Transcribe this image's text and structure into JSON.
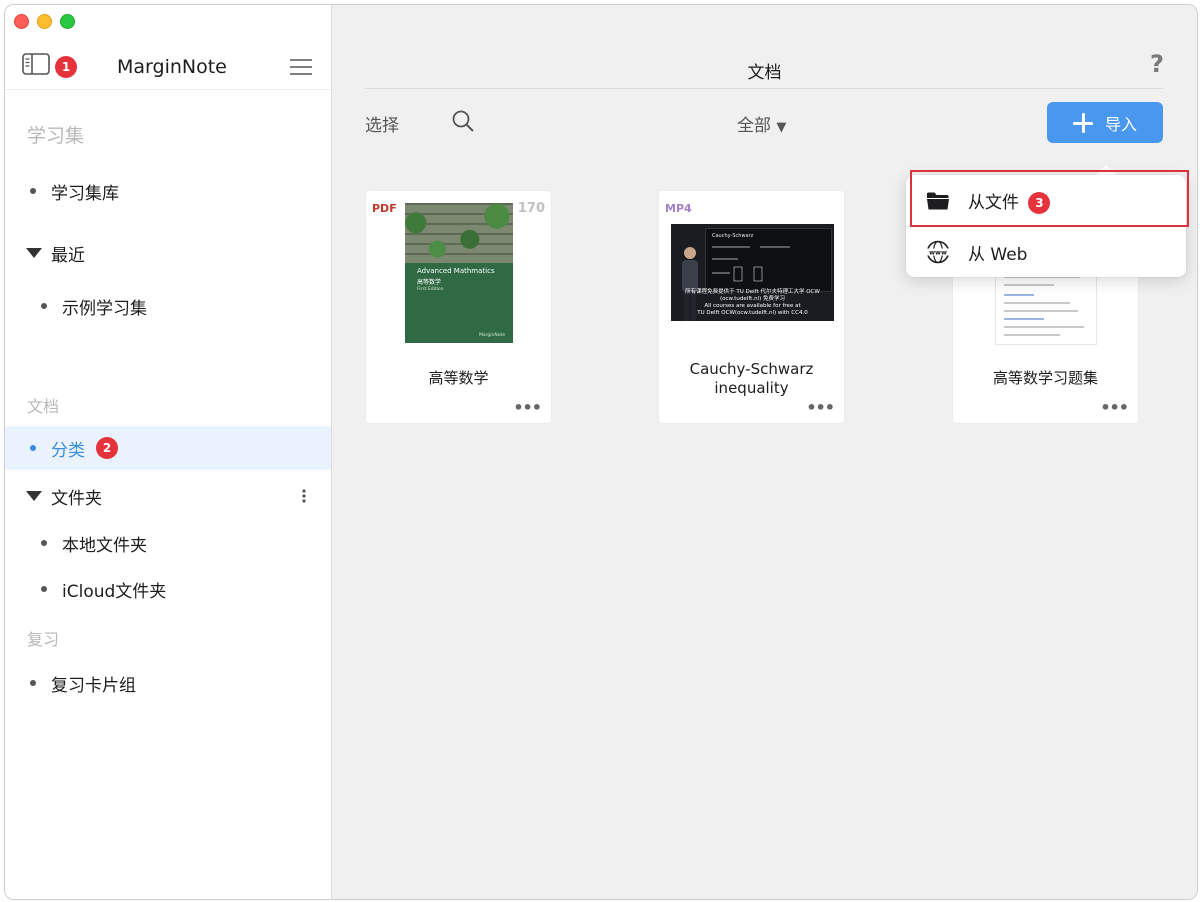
{
  "app": {
    "title": "MarginNote"
  },
  "badges": {
    "sidebar_toggle": "1",
    "category": "2",
    "from_file": "3"
  },
  "sidebar": {
    "section_notebooks": "学习集",
    "notebook_library": "学习集库",
    "recent": "最近",
    "recent_items": [
      "示例学习集"
    ],
    "section_documents": "文档",
    "category": "分类",
    "folders": "文件夹",
    "folder_items": [
      "本地文件夹",
      "iCloud文件夹"
    ],
    "section_review": "复习",
    "review_decks": "复习卡片组"
  },
  "main": {
    "title": "文档",
    "help": "?",
    "select_label": "选择",
    "filter_label": "全部",
    "filter_caret": "▼",
    "import_label": "导入"
  },
  "documents": [
    {
      "type": "PDF",
      "type_color": "#c0392b",
      "pages": "170",
      "name": "高等数学",
      "cover": {
        "title": "Advanced Mathmatics",
        "subtitle": "高等数学",
        "edition": "First Edition",
        "publisher": "MarginNote"
      }
    },
    {
      "type": "MP4",
      "type_color": "#a77fc7",
      "name": "Cauchy-Schwarz inequality",
      "cover": {
        "board_title": "Cauchy-Schwarz",
        "caption_lines": [
          "所有课程免费提供于 TU Delft 代尔夫特理工大学 OCW (ocw.tudelft.nl) 免费学习",
          "All courses are available for free at",
          "TU Delft OCW(ocw.tudelft.nl) with CC4.0"
        ]
      }
    },
    {
      "type": "",
      "name": "高等数学习题集"
    }
  ],
  "import_menu": {
    "items": [
      {
        "label": "从文件",
        "icon": "folder-icon"
      },
      {
        "label": "从 Web",
        "icon": "www-globe-icon"
      }
    ],
    "www_text": "www"
  },
  "colors": {
    "accent": "#4a97ef",
    "badge": "#e5323b",
    "highlight": "#d9333e",
    "active_text": "#3a8be0"
  }
}
